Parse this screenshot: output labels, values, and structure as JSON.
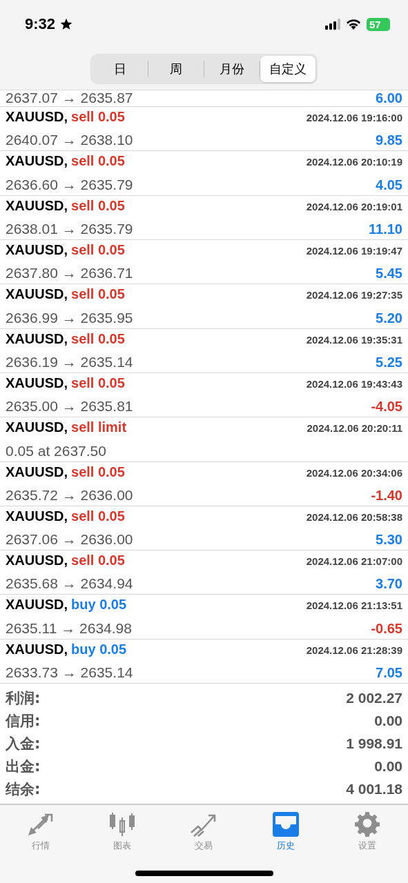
{
  "status_bar": {
    "time": "9:32",
    "battery": "57"
  },
  "period_tabs": [
    {
      "label": "日",
      "selected": false
    },
    {
      "label": "周",
      "selected": false
    },
    {
      "label": "月份",
      "selected": false
    },
    {
      "label": "自定义",
      "selected": true
    }
  ],
  "partial_row": {
    "prices": "2637.07 → 2635.87",
    "profit": "6.00",
    "loss": false
  },
  "deals": [
    {
      "symbol": "XAUUSD,",
      "kind": "sell",
      "action": "sell 0.05",
      "time": "2024.12.06 19:16:00",
      "prices": "2640.07 → 2638.10",
      "profit": "9.85",
      "loss": false
    },
    {
      "symbol": "XAUUSD,",
      "kind": "sell",
      "action": "sell 0.05",
      "time": "2024.12.06 20:10:19",
      "prices": "2636.60 → 2635.79",
      "profit": "4.05",
      "loss": false
    },
    {
      "symbol": "XAUUSD,",
      "kind": "sell",
      "action": "sell 0.05",
      "time": "2024.12.06 20:19:01",
      "prices": "2638.01 → 2635.79",
      "profit": "11.10",
      "loss": false
    },
    {
      "symbol": "XAUUSD,",
      "kind": "sell",
      "action": "sell 0.05",
      "time": "2024.12.06 19:19:47",
      "prices": "2637.80 → 2636.71",
      "profit": "5.45",
      "loss": false
    },
    {
      "symbol": "XAUUSD,",
      "kind": "sell",
      "action": "sell 0.05",
      "time": "2024.12.06 19:27:35",
      "prices": "2636.99 → 2635.95",
      "profit": "5.20",
      "loss": false
    },
    {
      "symbol": "XAUUSD,",
      "kind": "sell",
      "action": "sell 0.05",
      "time": "2024.12.06 19:35:31",
      "prices": "2636.19 → 2635.14",
      "profit": "5.25",
      "loss": false
    },
    {
      "symbol": "XAUUSD,",
      "kind": "sell",
      "action": "sell 0.05",
      "time": "2024.12.06 19:43:43",
      "prices": "2635.00 → 2635.81",
      "profit": "-4.05",
      "loss": true
    },
    {
      "symbol": "XAUUSD,",
      "kind": "sell",
      "action": "sell limit",
      "time": "2024.12.06 20:20:11",
      "prices": "0.05 at 2637.50"
    },
    {
      "symbol": "XAUUSD,",
      "kind": "sell",
      "action": "sell 0.05",
      "time": "2024.12.06 20:34:06",
      "prices": "2635.72 → 2636.00",
      "profit": "-1.40",
      "loss": true
    },
    {
      "symbol": "XAUUSD,",
      "kind": "sell",
      "action": "sell 0.05",
      "time": "2024.12.06 20:58:38",
      "prices": "2637.06 → 2636.00",
      "profit": "5.30",
      "loss": false
    },
    {
      "symbol": "XAUUSD,",
      "kind": "sell",
      "action": "sell 0.05",
      "time": "2024.12.06 21:07:00",
      "prices": "2635.68 → 2634.94",
      "profit": "3.70",
      "loss": false
    },
    {
      "symbol": "XAUUSD,",
      "kind": "buy",
      "action": "buy 0.05",
      "time": "2024.12.06 21:13:51",
      "prices": "2635.11 → 2634.98",
      "profit": "-0.65",
      "loss": true
    },
    {
      "symbol": "XAUUSD,",
      "kind": "buy",
      "action": "buy 0.05",
      "time": "2024.12.06 21:28:39",
      "prices": "2633.73 → 2635.14",
      "profit": "7.05",
      "loss": false
    }
  ],
  "summary": [
    {
      "label": "利润:",
      "value": "2 002.27"
    },
    {
      "label": "信用:",
      "value": "0.00"
    },
    {
      "label": "入金:",
      "value": "1 998.91"
    },
    {
      "label": "出金:",
      "value": "0.00"
    },
    {
      "label": "结余:",
      "value": "4 001.18"
    }
  ],
  "tab_bar": [
    {
      "label": "行情",
      "kind": "quotes",
      "selected": false
    },
    {
      "label": "图表",
      "kind": "chart",
      "selected": false
    },
    {
      "label": "交易",
      "kind": "trade",
      "selected": false
    },
    {
      "label": "历史",
      "kind": "history",
      "selected": true
    },
    {
      "label": "设置",
      "kind": "settings",
      "selected": false
    }
  ]
}
